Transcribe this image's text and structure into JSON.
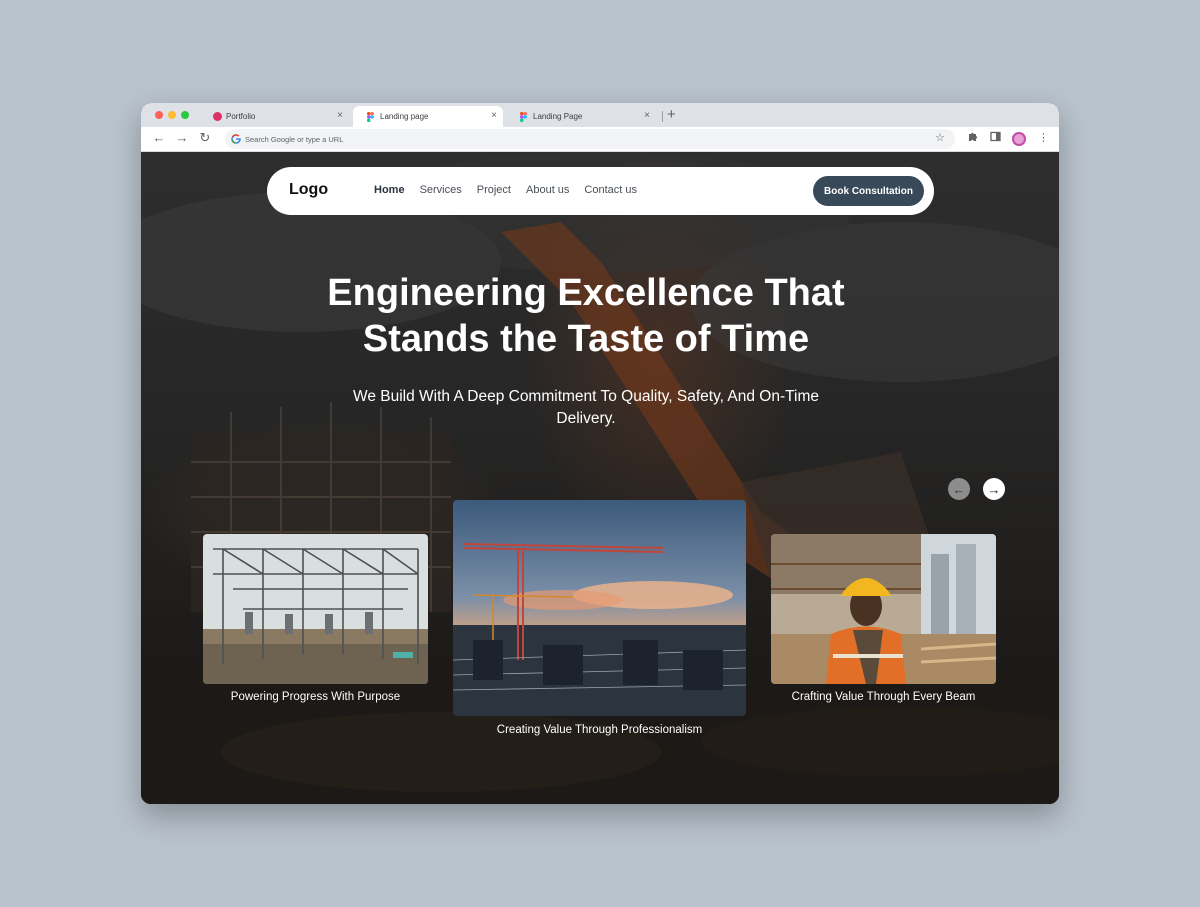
{
  "browser": {
    "tabs": [
      {
        "label": "Portfolio",
        "icon": "portfolio-favicon-icon"
      },
      {
        "label": "Landing page",
        "icon": "figma-icon"
      },
      {
        "label": "Landing Page",
        "icon": "figma-icon"
      }
    ],
    "address_placeholder": "Search Google or type a URL"
  },
  "site": {
    "logo": "Logo",
    "nav": [
      "Home",
      "Services",
      "Project",
      "About us",
      "Contact us"
    ],
    "cta": "Book Consultation",
    "hero": {
      "title_line1": "Engineering Excellence That",
      "title_line2": "Stands the Taste of Time",
      "subtitle_line1": "We Build With A Deep Commitment To Quality, Safety, And On-Time",
      "subtitle_line2": "Delivery."
    },
    "cards": [
      {
        "caption": "Powering Progress With Purpose",
        "image": "electrical-substation"
      },
      {
        "caption": "Creating Value Through Professionalism",
        "image": "construction-cranes-at-sunset"
      },
      {
        "caption": "Crafting Value Through Every Beam",
        "image": "construction-worker-in-hard-hat"
      }
    ],
    "carousel": {
      "prev": "arrow-left-icon",
      "next": "arrow-right-icon"
    }
  },
  "colors": {
    "page_bg": "#b9c3cd",
    "cta_bg": "#38495a",
    "nav_active": "#2a3340"
  }
}
